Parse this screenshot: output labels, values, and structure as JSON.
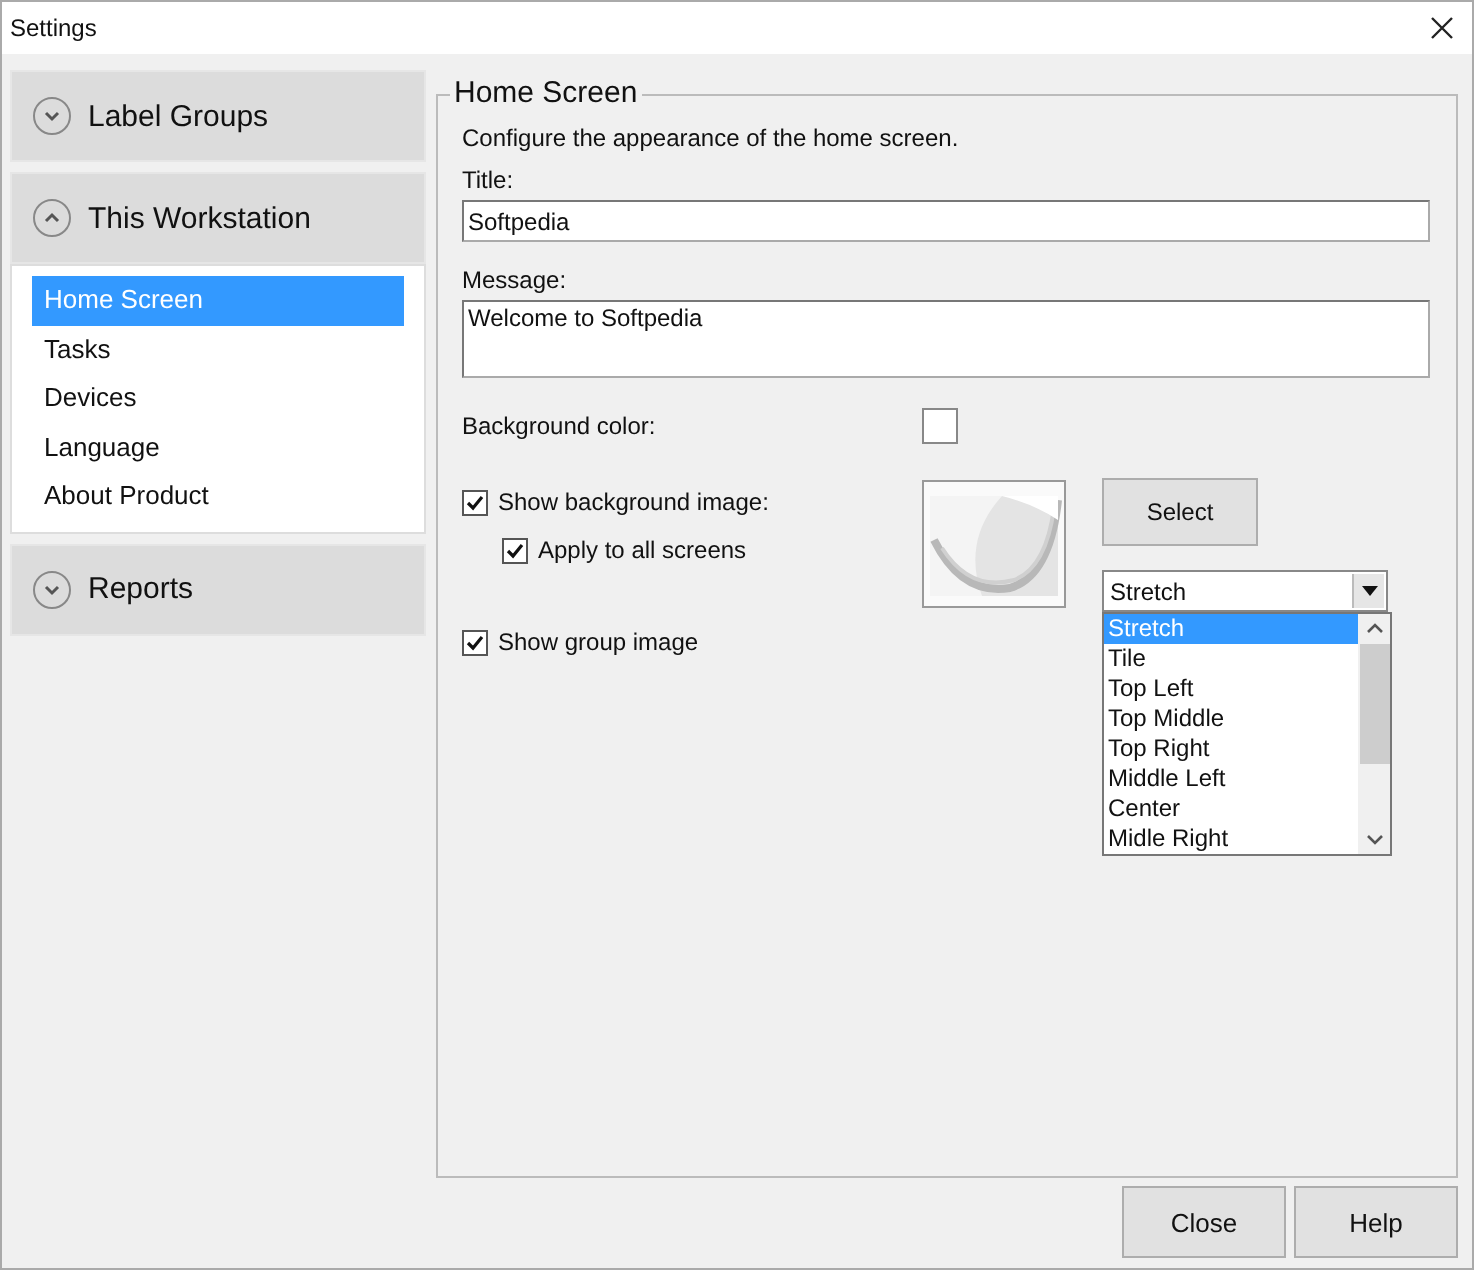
{
  "window": {
    "title": "Settings"
  },
  "sidebar": {
    "groups": [
      {
        "label": "Label Groups",
        "expanded": false
      },
      {
        "label": "This Workstation",
        "expanded": true,
        "items": [
          {
            "label": "Home Screen",
            "selected": true
          },
          {
            "label": "Tasks",
            "selected": false
          },
          {
            "label": "Devices",
            "selected": false
          },
          {
            "label": "Language",
            "selected": false
          },
          {
            "label": "About Product",
            "selected": false
          }
        ]
      },
      {
        "label": "Reports",
        "expanded": false
      }
    ]
  },
  "panel": {
    "title": "Home Screen",
    "description": "Configure the appearance of the home screen.",
    "title_label": "Title:",
    "title_value": "Softpedia",
    "message_label": "Message:",
    "message_value": "Welcome to Softpedia",
    "background_color_label": "Background color:",
    "options": [
      {
        "label": "Show background image:",
        "checked": true,
        "children": [
          {
            "label": "Apply to all screens",
            "checked": true
          }
        ]
      },
      {
        "label": "Show group image",
        "checked": true
      }
    ],
    "select_button": "Select",
    "image_mode": {
      "value": "Stretch",
      "open": true,
      "options": [
        {
          "label": "Stretch",
          "selected": true
        },
        {
          "label": "Tile",
          "selected": false
        },
        {
          "label": "Top Left",
          "selected": false
        },
        {
          "label": "Top Middle",
          "selected": false
        },
        {
          "label": "Top Right",
          "selected": false
        },
        {
          "label": "Middle Left",
          "selected": false
        },
        {
          "label": "Center",
          "selected": false
        },
        {
          "label": "Midle Right",
          "selected": false
        }
      ]
    }
  },
  "buttons": [
    "Close",
    "Help"
  ]
}
